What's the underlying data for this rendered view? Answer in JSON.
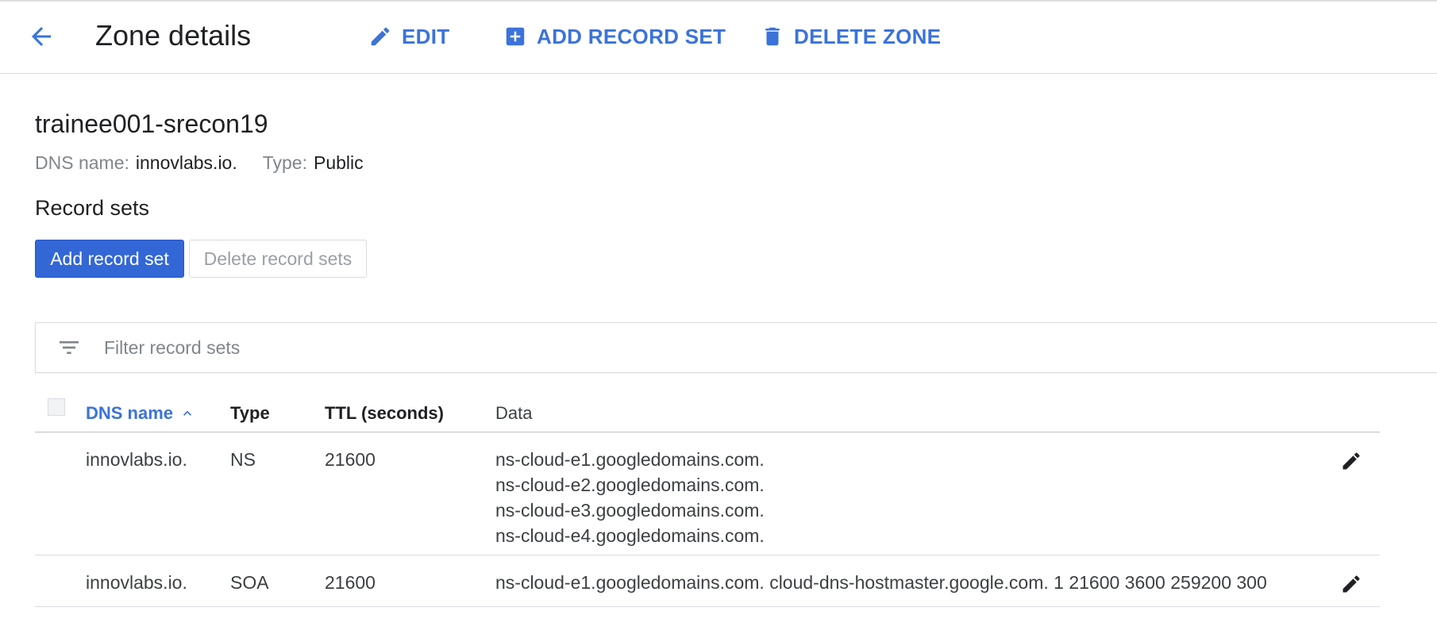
{
  "header": {
    "title": "Zone details",
    "actions": {
      "edit": "EDIT",
      "add_record_set": "ADD RECORD SET",
      "delete_zone": "DELETE ZONE"
    }
  },
  "zone": {
    "name": "trainee001-srecon19",
    "dns_name_label": "DNS name:",
    "dns_name_value": "innovlabs.io.",
    "type_label": "Type:",
    "type_value": "Public"
  },
  "record_sets": {
    "title": "Record sets",
    "add_button": "Add record set",
    "delete_button": "Delete record sets",
    "filter_placeholder": "Filter record sets",
    "columns": {
      "dns_name": "DNS name",
      "type": "Type",
      "ttl": "TTL (seconds)",
      "data": "Data"
    },
    "rows": [
      {
        "dns_name": "innovlabs.io.",
        "type": "NS",
        "ttl": "21600",
        "data": [
          "ns-cloud-e1.googledomains.com.",
          "ns-cloud-e2.googledomains.com.",
          "ns-cloud-e3.googledomains.com.",
          "ns-cloud-e4.googledomains.com."
        ]
      },
      {
        "dns_name": "innovlabs.io.",
        "type": "SOA",
        "ttl": "21600",
        "data": [
          "ns-cloud-e1.googledomains.com. cloud-dns-hostmaster.google.com. 1 21600 3600 259200 300"
        ]
      }
    ]
  },
  "colors": {
    "accent": "#3b73d9",
    "primary_button": "#3367d6",
    "text": "#202124",
    "muted": "#80868b"
  },
  "icons": {
    "back": "arrow-back-icon",
    "edit": "pencil-icon",
    "add": "plus-box-icon",
    "delete": "trash-icon",
    "filter": "filter-list-icon",
    "sort": "chevron-up-icon"
  }
}
